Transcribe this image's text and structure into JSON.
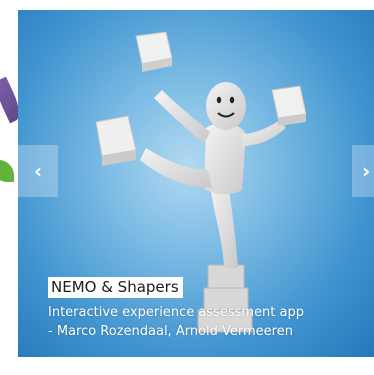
{
  "slideshow": {
    "prev_icon": "‹",
    "next_icon": "›",
    "current_slide": {
      "image_subject": "white humanoid figure juggling cubes",
      "title": "NEMO & Shapers",
      "description_line1": "Interactive experience assessment app",
      "description_line2": "- Marco Rozendaal, Arnold Vermeeren"
    }
  },
  "colors": {
    "slide_background": "#3f93cf",
    "caption_title_bg": "#ffffff",
    "caption_text": "#ffffff"
  }
}
